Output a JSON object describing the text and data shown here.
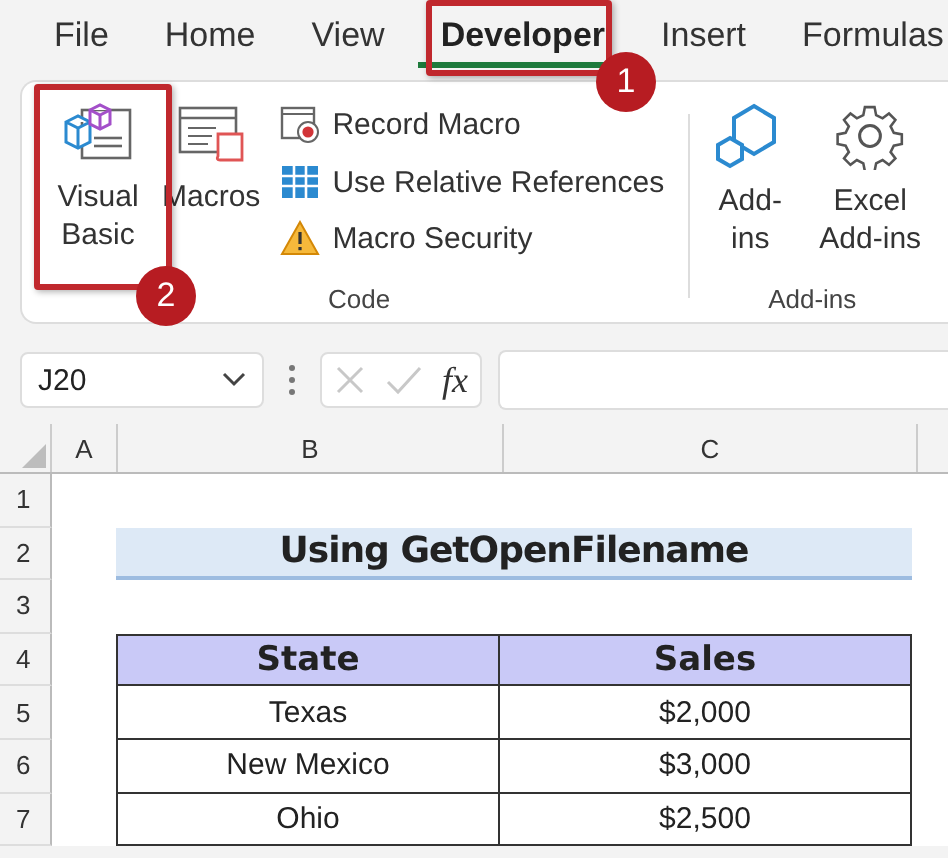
{
  "tabs": [
    {
      "label": "File",
      "selected": false
    },
    {
      "label": "Home",
      "selected": false
    },
    {
      "label": "View",
      "selected": false
    },
    {
      "label": "Developer",
      "selected": true
    },
    {
      "label": "Insert",
      "selected": false
    },
    {
      "label": "Formulas",
      "selected": false
    }
  ],
  "ribbon": {
    "groups": [
      {
        "label": "Code",
        "large_buttons": [
          {
            "label": "Visual Basic"
          },
          {
            "label": "Macros"
          }
        ],
        "small_buttons": [
          {
            "label": "Record Macro"
          },
          {
            "label": "Use Relative References"
          },
          {
            "label": "Macro Security"
          }
        ]
      },
      {
        "label": "Add-ins",
        "large_buttons": [
          {
            "label": "Add-ins"
          },
          {
            "label": "Excel Add-ins"
          }
        ]
      }
    ]
  },
  "formula_bar": {
    "name_box": "J20",
    "function_label": "fx",
    "enter_disabled": true
  },
  "columns": [
    "A",
    "B",
    "C"
  ],
  "rows": [
    "1",
    "2",
    "3",
    "4",
    "5",
    "6",
    "7"
  ],
  "sheet": {
    "title": "Using GetOpenFilename",
    "table": {
      "headers": [
        "State",
        "Sales"
      ],
      "rows": [
        [
          "Texas",
          "$2,000"
        ],
        [
          "New Mexico",
          "$3,000"
        ],
        [
          "Ohio",
          "$2,500"
        ]
      ]
    }
  },
  "callouts": [
    {
      "label": "1"
    },
    {
      "label": "2"
    }
  ]
}
